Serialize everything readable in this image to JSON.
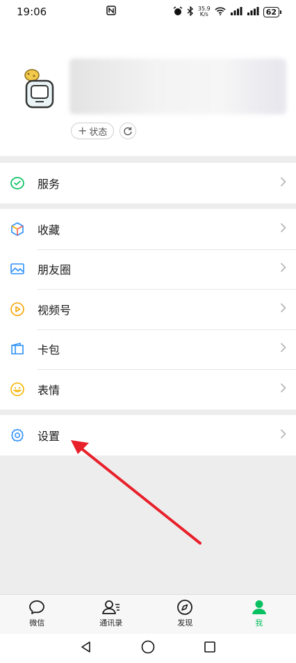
{
  "status_bar": {
    "time": "19:06",
    "net_speed": "35.9\nK/s",
    "battery": "62"
  },
  "profile": {
    "status_button_label": "状态"
  },
  "menu_groups": [
    {
      "items": [
        {
          "label": "服务",
          "icon": "wechat-pay-icon"
        }
      ]
    },
    {
      "items": [
        {
          "label": "收藏",
          "icon": "favorites-cube-icon"
        },
        {
          "label": "朋友圈",
          "icon": "moments-photo-icon"
        },
        {
          "label": "视频号",
          "icon": "channels-play-icon"
        },
        {
          "label": "卡包",
          "icon": "card-wallet-icon"
        },
        {
          "label": "表情",
          "icon": "sticker-smile-icon"
        }
      ]
    },
    {
      "items": [
        {
          "label": "设置",
          "icon": "settings-gear-icon"
        }
      ]
    }
  ],
  "tabs": [
    {
      "label": "微信",
      "icon": "chat-bubble-icon",
      "active": false
    },
    {
      "label": "通讯录",
      "icon": "contacts-icon",
      "active": false
    },
    {
      "label": "发现",
      "icon": "compass-icon",
      "active": false
    },
    {
      "label": "我",
      "icon": "person-icon",
      "active": true
    }
  ],
  "colors": {
    "accent": "#07c160",
    "annotation_arrow": "#e8202a",
    "background": "#ededed"
  }
}
